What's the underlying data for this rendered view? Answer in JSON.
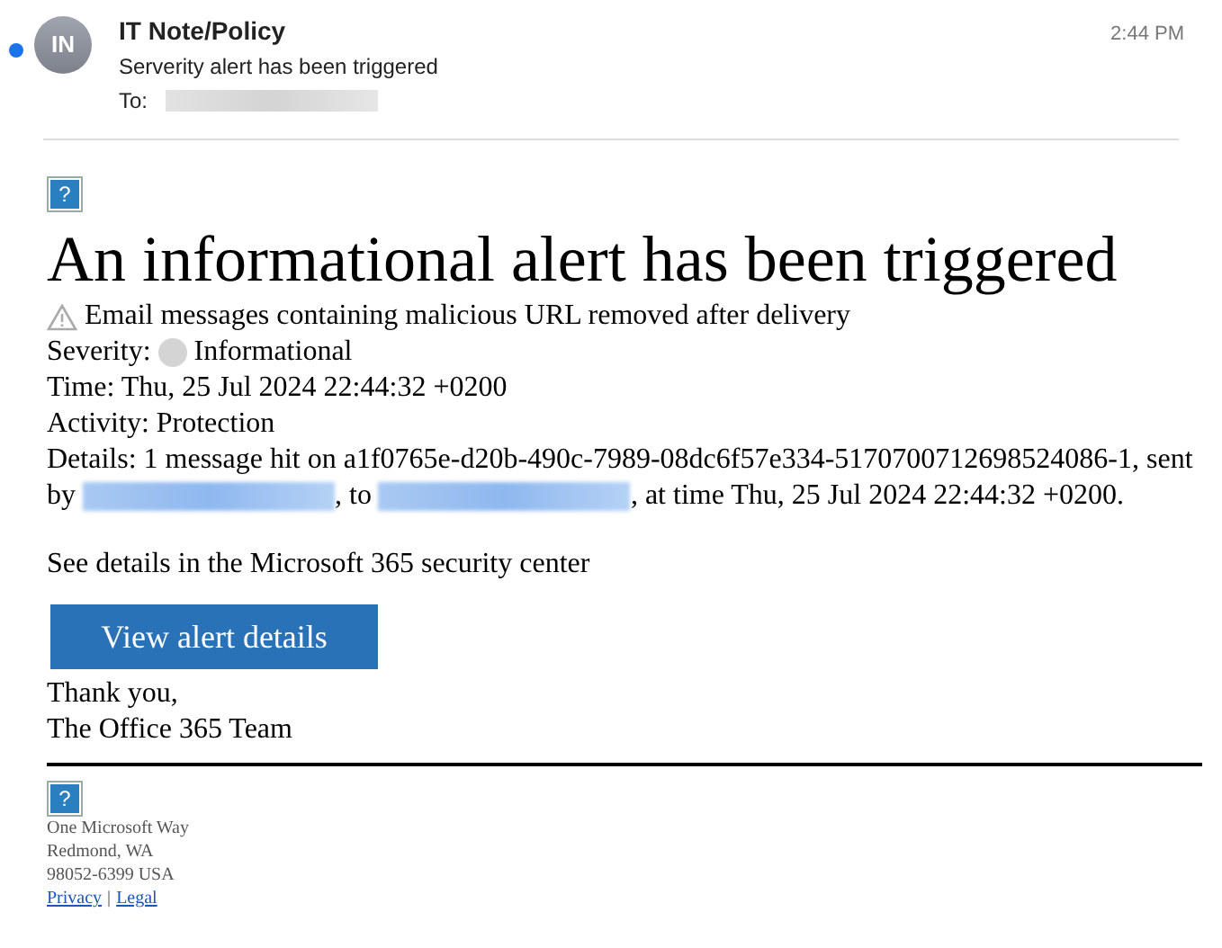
{
  "message": {
    "unread": true,
    "avatar": "IN",
    "sender": "IT Note/Policy",
    "subject": "Serverity alert has been triggered",
    "to_label": "To:",
    "time": "2:44 PM"
  },
  "body": {
    "image_placeholder": "?",
    "heading": "An informational alert has been triggered",
    "alert_name": "Email messages containing malicious URL removed after delivery",
    "severity_label": "Severity:",
    "severity": "Informational",
    "time": "Time: Thu, 25 Jul 2024 22:44:32 +0200",
    "activity": "Activity: Protection",
    "details_start": "Details: 1 message hit on a1f0765e-d20b-490c-7989-08dc6f57e334-5170700712698524086-1, sent by",
    "details_to": ", to",
    "details_end": ", at time Thu, 25 Jul 2024 22:44:32 +0200.",
    "see_details": "See details in the Microsoft 365 security center",
    "button": "View alert details",
    "thanks": "Thank you,",
    "team": "The Office 365 Team"
  },
  "footer": {
    "image_placeholder": "?",
    "address": [
      "One Microsoft Way",
      "Redmond, WA",
      "98052-6399 USA"
    ],
    "links": [
      "Privacy",
      "Legal"
    ],
    "separator": "|"
  }
}
